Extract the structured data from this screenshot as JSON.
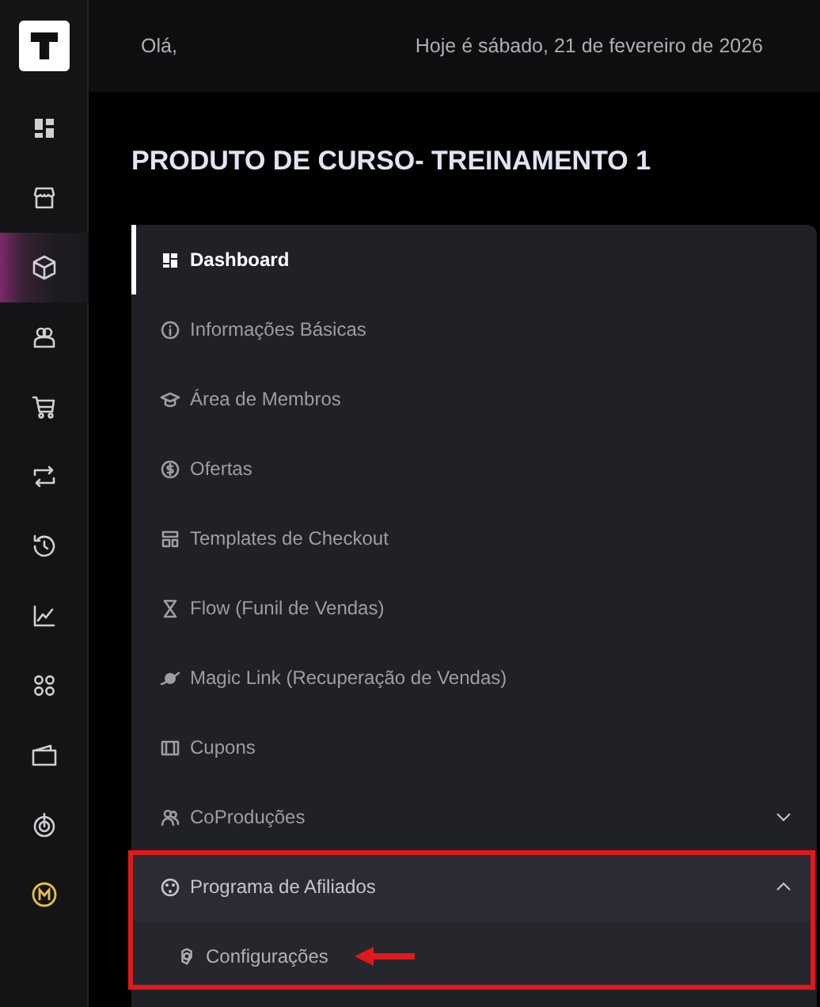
{
  "rail": {
    "items": [
      {
        "selected": false
      },
      {
        "selected": false
      },
      {
        "selected": true
      },
      {
        "selected": false
      },
      {
        "selected": false
      },
      {
        "selected": false
      },
      {
        "selected": false
      },
      {
        "selected": false
      },
      {
        "selected": false
      },
      {
        "selected": false
      },
      {
        "selected": false
      },
      {
        "selected": false
      }
    ]
  },
  "header": {
    "greeting": "Olá,",
    "date": "Hoje é sábado, 21 de fevereiro de 2026"
  },
  "title": "PRODUTO DE CURSO- TREINAMENTO 1",
  "menu": [
    {
      "label": "Dashboard",
      "selected": true
    },
    {
      "label": "Informações Básicas",
      "selected": false
    },
    {
      "label": "Área de Membros",
      "selected": false
    },
    {
      "label": "Ofertas",
      "selected": false
    },
    {
      "label": "Templates de Checkout",
      "selected": false
    },
    {
      "label": "Flow (Funil de Vendas)",
      "selected": false
    },
    {
      "label": "Magic Link (Recuperação de Vendas)",
      "selected": false
    },
    {
      "label": "Cupons",
      "selected": false
    },
    {
      "label": "CoProduções",
      "selected": false,
      "expanded": false
    },
    {
      "label": "Programa de Afiliados",
      "selected": false,
      "expanded": true,
      "highlighted": true,
      "children": [
        {
          "label": "Configurações",
          "selected": false,
          "pointed": true
        }
      ]
    }
  ]
}
